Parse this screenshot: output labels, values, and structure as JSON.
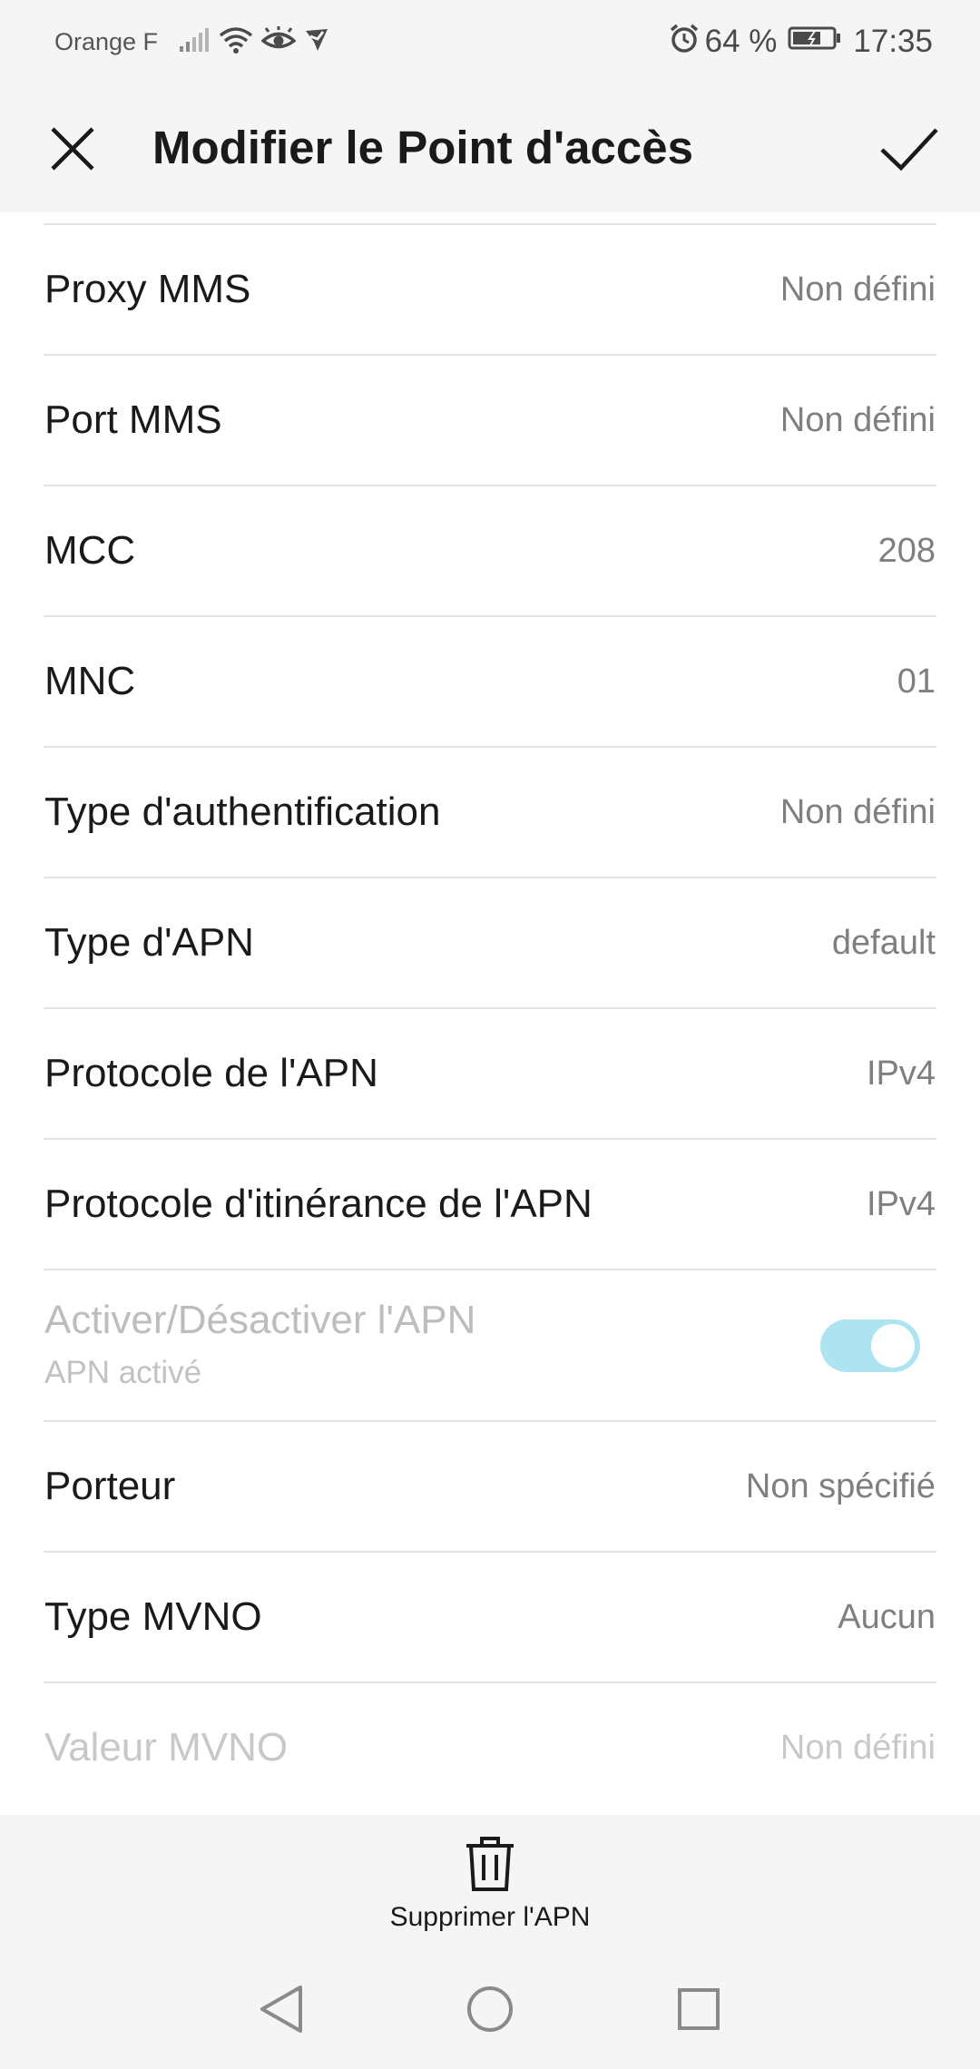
{
  "status_bar": {
    "carrier": "Orange F",
    "battery_percent": "64 %",
    "time": "17:35",
    "icons": [
      "signal-icon",
      "wifi-icon",
      "eye-comfort-icon",
      "notification-app-icon",
      "alarm-icon",
      "battery-icon"
    ]
  },
  "header": {
    "title": "Modifier le Point d'accès",
    "close_icon": "close-icon",
    "confirm_icon": "checkmark-icon"
  },
  "settings": {
    "rows": [
      {
        "label": "Proxy MMS",
        "value": "Non défini"
      },
      {
        "label": "Port MMS",
        "value": "Non défini"
      },
      {
        "label": "MCC",
        "value": "208"
      },
      {
        "label": "MNC",
        "value": "01"
      },
      {
        "label": "Type d'authentification",
        "value": "Non défini"
      },
      {
        "label": "Type d'APN",
        "value": "default"
      },
      {
        "label": "Protocole de l'APN",
        "value": "IPv4"
      },
      {
        "label": "Protocole d'itinérance de l'APN",
        "value": "IPv4"
      }
    ],
    "toggle_row": {
      "label": "Activer/Désactiver l'APN",
      "sublabel": "APN activé",
      "enabled": true,
      "color": "#aee4f2"
    },
    "rows_after": [
      {
        "label": "Porteur",
        "value": "Non spécifié"
      },
      {
        "label": "Type MVNO",
        "value": "Aucun"
      },
      {
        "label": "Valeur MVNO",
        "value": "Non défini"
      }
    ]
  },
  "action_bar": {
    "delete_label": "Supprimer l'APN",
    "delete_icon": "trash-icon"
  },
  "nav_bar": {
    "icons": [
      "back-icon",
      "home-icon",
      "recents-icon"
    ]
  }
}
